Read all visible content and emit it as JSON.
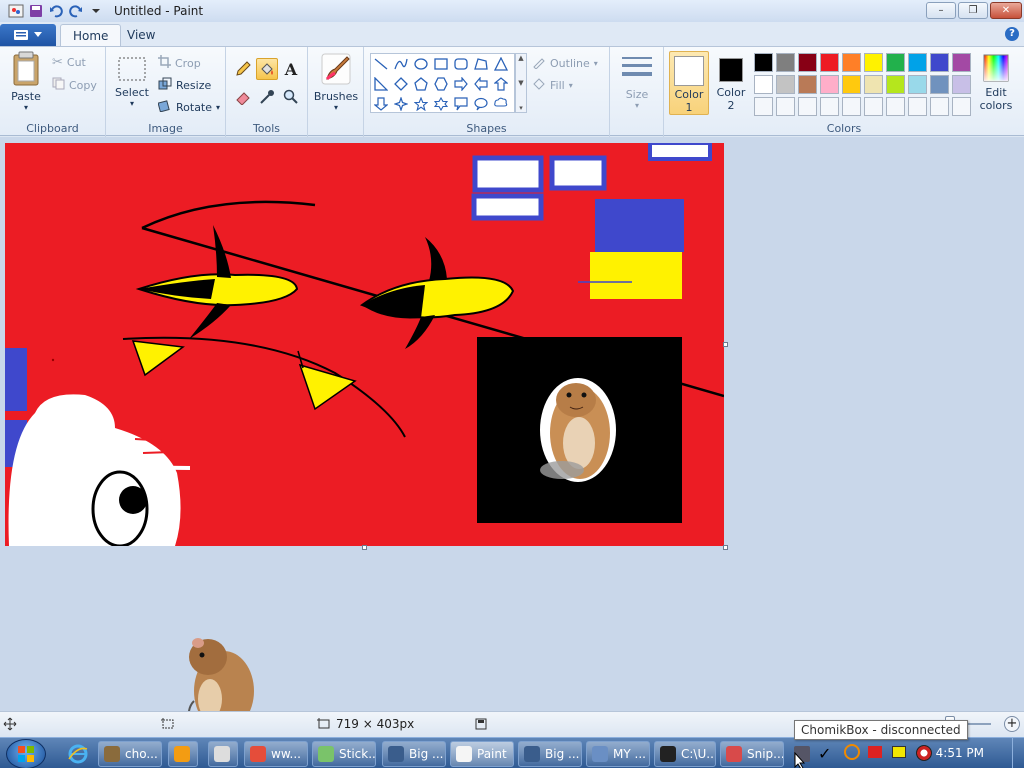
{
  "window": {
    "title": "Untitled - Paint",
    "controls": {
      "minimize": "–",
      "maximize": "❐",
      "close": "✕"
    }
  },
  "ribbon_tabs": [
    "Home",
    "View"
  ],
  "help_label": "?",
  "clipboard": {
    "paste": "Paste",
    "cut": "Cut",
    "copy": "Copy",
    "group": "Clipboard"
  },
  "image": {
    "select": "Select",
    "crop": "Crop",
    "resize": "Resize",
    "rotate": "Rotate",
    "group": "Image"
  },
  "tools": {
    "group": "Tools",
    "text_glyph": "A"
  },
  "brushes": {
    "label": "Brushes"
  },
  "shapes": {
    "outline": "Outline",
    "fill": "Fill",
    "group": "Shapes"
  },
  "size": {
    "label": "Size"
  },
  "colors": {
    "color1_label_a": "Color",
    "color1_label_b": "1",
    "color2_label_a": "Color",
    "color2_label_b": "2",
    "color1": "#ffffff",
    "color2": "#000000",
    "edit_a": "Edit",
    "edit_b": "colors",
    "group": "Colors",
    "palette_row1": [
      "#000000",
      "#7f7f7f",
      "#880015",
      "#ed1c24",
      "#ff7f27",
      "#fff200",
      "#22b14c",
      "#00a2e8",
      "#3f48cc",
      "#a349a4"
    ],
    "palette_row2": [
      "#ffffff",
      "#c3c3c3",
      "#b97a57",
      "#ffaec9",
      "#ffc90e",
      "#efe4b0",
      "#b5e61d",
      "#99d9ea",
      "#7092be",
      "#c8bfe7"
    ]
  },
  "canvas": {
    "background": "#ec1c24"
  },
  "status": {
    "dimensions": "719 × 403px"
  },
  "taskbar": {
    "items": [
      "cho...",
      "",
      "",
      "ww...",
      "Stick...",
      "Big ...",
      "Paint",
      "Big ...",
      "MY ...",
      "C:\\U...",
      "Snip..."
    ],
    "clock": "4:51 PM"
  },
  "tooltip": "ChomikBox - disconnected"
}
